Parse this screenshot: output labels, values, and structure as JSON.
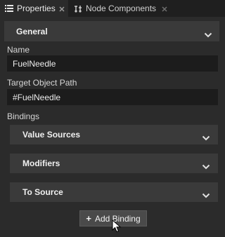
{
  "tabs": [
    {
      "label": "Properties",
      "icon": "list-icon",
      "active": true
    },
    {
      "label": "Node Components",
      "icon": "node-components-icon",
      "active": false
    }
  ],
  "general": {
    "title": "General"
  },
  "name": {
    "label": "Name",
    "value": "FuelNeedle"
  },
  "target": {
    "label": "Target Object Path",
    "value": "#FuelNeedle"
  },
  "bindings": {
    "label": "Bindings",
    "sections": [
      "Value Sources",
      "Modifiers",
      "To Source"
    ],
    "add_button": "Add Binding"
  },
  "colors": {
    "background": "#2b2b2b",
    "header": "#3a3a3a",
    "field": "#1c1c1c",
    "tabbar": "#1f1f1f"
  }
}
